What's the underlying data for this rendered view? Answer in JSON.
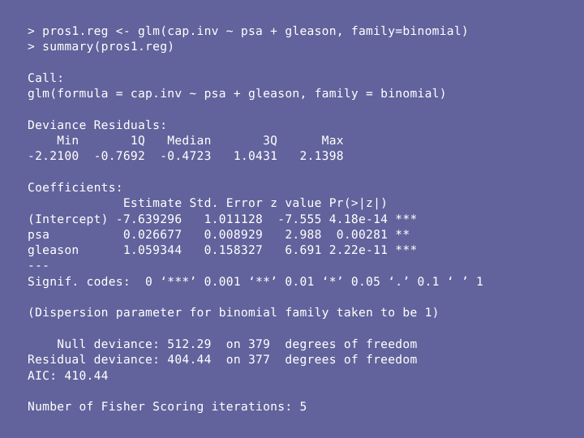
{
  "terminal": {
    "app": "R Console",
    "background_color": "#62629c",
    "text_color": "#ffffff",
    "prompt_symbol": ">",
    "lines": [
      "> pros1.reg <- glm(cap.inv ~ psa + gleason, family=binomial)",
      "> summary(pros1.reg)",
      "",
      "Call:",
      "glm(formula = cap.inv ~ psa + gleason, family = binomial)",
      "",
      "Deviance Residuals:",
      "    Min       1Q   Median       3Q      Max",
      "-2.2100  -0.7692  -0.4723   1.0431   2.1398",
      "",
      "Coefficients:",
      "             Estimate Std. Error z value Pr(>|z|)",
      "(Intercept) -7.639296   1.011128  -7.555 4.18e-14 ***",
      "psa          0.026677   0.008929   2.988  0.00281 **",
      "gleason      1.059344   0.158327   6.691 2.22e-11 ***",
      "---",
      "Signif. codes:  0 ‘***’ 0.001 ‘**’ 0.01 ‘*’ 0.05 ‘.’ 0.1 ‘ ’ 1",
      "",
      "(Dispersion parameter for binomial family taken to be 1)",
      "",
      "    Null deviance: 512.29  on 379  degrees of freedom",
      "Residual deviance: 404.44  on 377  degrees of freedom",
      "AIC: 410.44",
      "",
      "Number of Fisher Scoring iterations: 5"
    ],
    "commands": [
      {
        "prompt": ">",
        "text": "pros1.reg <- glm(cap.inv ~ psa + gleason, family=binomial)"
      },
      {
        "prompt": ">",
        "text": "summary(pros1.reg)"
      }
    ],
    "call": {
      "header": "Call:",
      "formula": "glm(formula = cap.inv ~ psa + gleason, family = binomial)"
    },
    "deviance_residuals": {
      "header": "Deviance Residuals:",
      "columns": [
        "Min",
        "1Q",
        "Median",
        "3Q",
        "Max"
      ],
      "values": [
        "-2.2100",
        "-0.7692",
        "-0.4723",
        "1.0431",
        "2.1398"
      ]
    },
    "coefficients": {
      "header": "Coefficients:",
      "columns": [
        "Estimate",
        "Std. Error",
        "z value",
        "Pr(>|z|)"
      ],
      "rows": [
        {
          "term": "(Intercept)",
          "estimate": "-7.639296",
          "std_error": "1.011128",
          "z_value": "-7.555",
          "p_value": "4.18e-14",
          "signif": "***"
        },
        {
          "term": "psa",
          "estimate": "0.026677",
          "std_error": "0.008929",
          "z_value": "2.988",
          "p_value": "0.00281",
          "signif": "**"
        },
        {
          "term": "gleason",
          "estimate": "1.059344",
          "std_error": "0.158327",
          "z_value": "6.691",
          "p_value": "2.22e-11",
          "signif": "***"
        }
      ],
      "separator": "---",
      "signif_codes": "Signif. codes:  0 ‘***’ 0.001 ‘**’ 0.01 ‘*’ 0.05 ‘.’ 0.1 ‘ ’ 1"
    },
    "dispersion": "(Dispersion parameter for binomial family taken to be 1)",
    "deviance": {
      "null_label": "Null deviance:",
      "null_value": "512.29",
      "null_df": "379",
      "residual_label": "Residual deviance:",
      "residual_value": "404.44",
      "residual_df": "377",
      "df_suffix": "degrees of freedom",
      "on_label": "on",
      "aic_label": "AIC:",
      "aic_value": "410.44"
    },
    "iterations": {
      "label": "Number of Fisher Scoring iterations:",
      "value": "5",
      "full": "Number of Fisher Scoring iterations: 5"
    }
  }
}
